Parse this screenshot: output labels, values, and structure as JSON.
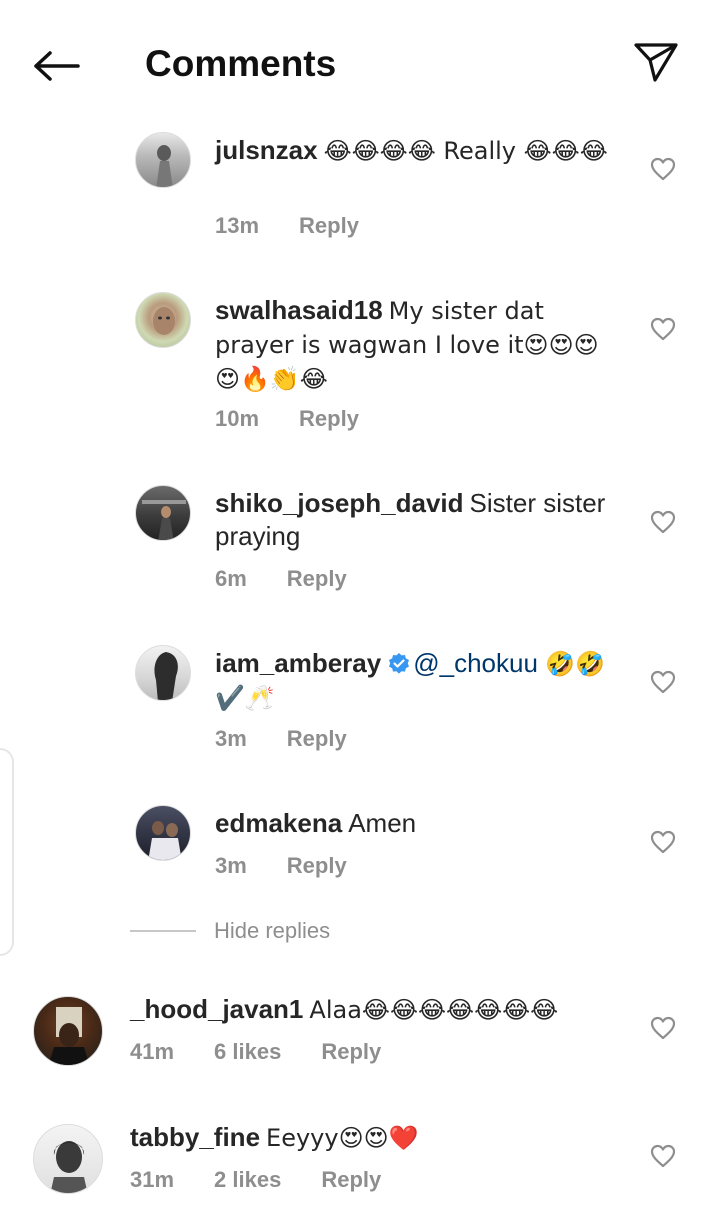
{
  "header": {
    "title": "Comments"
  },
  "comments": [
    {
      "username": "julsnzax",
      "text": "😂😂😂😂 Really 😂😂😂",
      "time": "13m",
      "likes": "",
      "reply": "Reply"
    },
    {
      "username": "swalhasaid18",
      "text": "My sister dat prayer is wagwan I love it😍😍😍😍🔥👏😂",
      "time": "10m",
      "likes": "",
      "reply": "Reply"
    },
    {
      "username": "shiko_joseph_david",
      "text": "Sister sister praying",
      "time": "6m",
      "likes": "",
      "reply": "Reply"
    },
    {
      "username": "iam_amberay",
      "mention": "@_chokuu",
      "text": "🤣🤣✔️🥂",
      "time": "3m",
      "likes": "",
      "reply": "Reply"
    },
    {
      "username": "edmakena",
      "text": "Amen",
      "time": "3m",
      "likes": "",
      "reply": "Reply"
    },
    {
      "username": "_hood_javan1",
      "text": "Alaa😂😂😂😂😂😂😂",
      "time": "41m",
      "likes": "6 likes",
      "reply": "Reply"
    },
    {
      "username": "tabby_fine",
      "text": "Eeyyy😍😍❤️",
      "time": "31m",
      "likes": "2 likes",
      "reply": "Reply"
    }
  ],
  "hide_replies": "Hide replies",
  "colors": {
    "text": "#262626",
    "muted": "#8e8e8e",
    "mention": "#00376b",
    "verified": "#3897f0"
  }
}
